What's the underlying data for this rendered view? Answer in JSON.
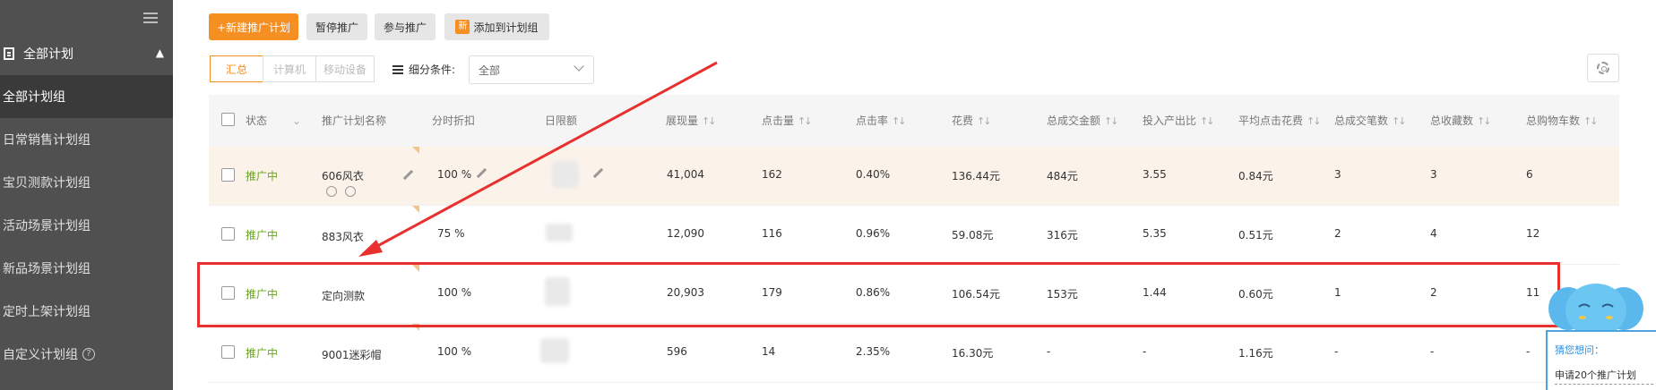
{
  "sidebar": {
    "section_title": "全部计划",
    "items": [
      {
        "label": "全部计划组",
        "active": true
      },
      {
        "label": "日常销售计划组"
      },
      {
        "label": "宝贝测款计划组"
      },
      {
        "label": "活动场景计划组"
      },
      {
        "label": "新品场景计划组"
      },
      {
        "label": "定时上架计划组"
      },
      {
        "label": "自定义计划组"
      }
    ]
  },
  "toolbar": {
    "new_plan": "+新建推广计划",
    "pause": "暂停推广",
    "join": "参与推广",
    "add_group_badge": "新",
    "add_group": "添加到计划组"
  },
  "filters": {
    "tabs": [
      "汇总",
      "计算机",
      "移动设备"
    ],
    "active_tab": "汇总",
    "breakdown_label": "细分条件:",
    "breakdown_value": "全部"
  },
  "table": {
    "headers": [
      "状态",
      "推广计划名称",
      "分时折扣",
      "日限额",
      "展现量",
      "点击量",
      "点击率",
      "花费",
      "总成交金额",
      "投入产出比",
      "平均点击花费",
      "总成交笔数",
      "总收藏数",
      "总购物车数"
    ],
    "rows": [
      {
        "status": "推广中",
        "name": "606风衣",
        "discount": "100 %",
        "impressions": "41,004",
        "clicks": "162",
        "ctr": "0.40%",
        "cost": "136.44元",
        "gmv": "484元",
        "roi": "3.55",
        "cpc": "0.84元",
        "orders": "3",
        "favorites": "3",
        "carts": "6"
      },
      {
        "status": "推广中",
        "name": "883风衣",
        "discount": "75 %",
        "impressions": "12,090",
        "clicks": "116",
        "ctr": "0.96%",
        "cost": "59.08元",
        "gmv": "316元",
        "roi": "5.35",
        "cpc": "0.51元",
        "orders": "2",
        "favorites": "4",
        "carts": "12"
      },
      {
        "status": "推广中",
        "name": "定向测款",
        "discount": "100 %",
        "impressions": "20,903",
        "clicks": "179",
        "ctr": "0.86%",
        "cost": "106.54元",
        "gmv": "153元",
        "roi": "1.44",
        "cpc": "0.60元",
        "orders": "1",
        "favorites": "2",
        "carts": "11"
      },
      {
        "status": "推广中",
        "name": "9001迷彩帽",
        "discount": "100 %",
        "impressions": "596",
        "clicks": "14",
        "ctr": "2.35%",
        "cost": "16.30元",
        "gmv": "-",
        "roi": "-",
        "cpc": "1.16元",
        "orders": "-",
        "favorites": "-",
        "carts": "-"
      }
    ]
  },
  "helper": {
    "question": "猜您想问：",
    "answer": "申请20个推广计划"
  },
  "colors": {
    "accent": "#f68f21",
    "annotation_red": "#e8302e",
    "status_green": "#6aa321",
    "sidebar_bg": "#505050"
  }
}
